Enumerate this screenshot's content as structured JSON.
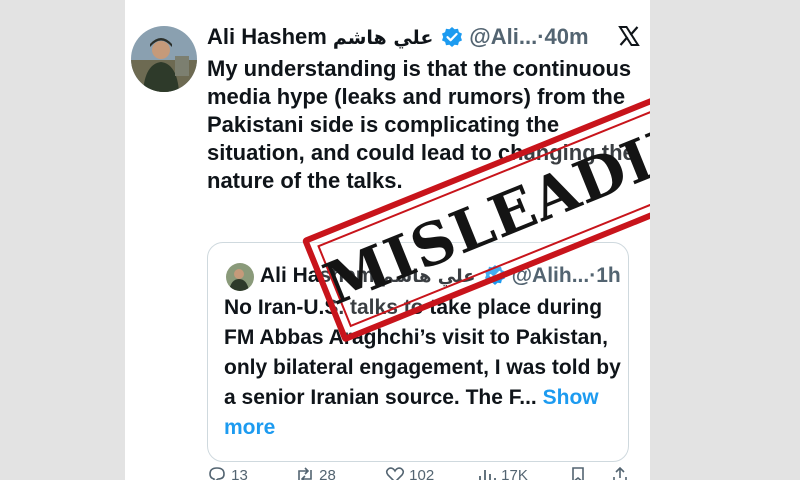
{
  "post": {
    "author_name": "Ali Hashem",
    "author_name_arabic": "علي هاشم",
    "handle": "@Ali...",
    "separator": "·",
    "time_ago": "40m",
    "platform_icon": "x-logo-icon",
    "verified_icon": "verified-badge-icon",
    "text": "My understanding is that the continuous media hype (leaks and rumors) from the Pakistani side is complicating the situation, and could lead to changing the nature of the talks."
  },
  "quoted_post": {
    "author_name": "Ali Hashem",
    "author_name_arabic": "علي هاشم",
    "handle": "@Alih...",
    "separator": "·",
    "time_ago": "1h",
    "text": "No Iran-U.S. talks to take place during FM Abbas Araghchi’s visit to Pakistan, only bilateral engagement, I was told by a senior Iranian source. The F...",
    "show_more_label": "Show more"
  },
  "actions": {
    "replies": "13",
    "reposts": "28",
    "likes": "102",
    "views": "17K",
    "icons": [
      "reply-icon",
      "repost-icon",
      "like-icon",
      "views-icon",
      "bookmark-icon",
      "share-icon"
    ]
  },
  "stamp": {
    "label": "MISLEADING",
    "color": "#c8141b"
  },
  "colors": {
    "accent": "#1d9bf0",
    "text": "#0f1419",
    "muted": "#536471",
    "background": "#e3e3e3"
  }
}
